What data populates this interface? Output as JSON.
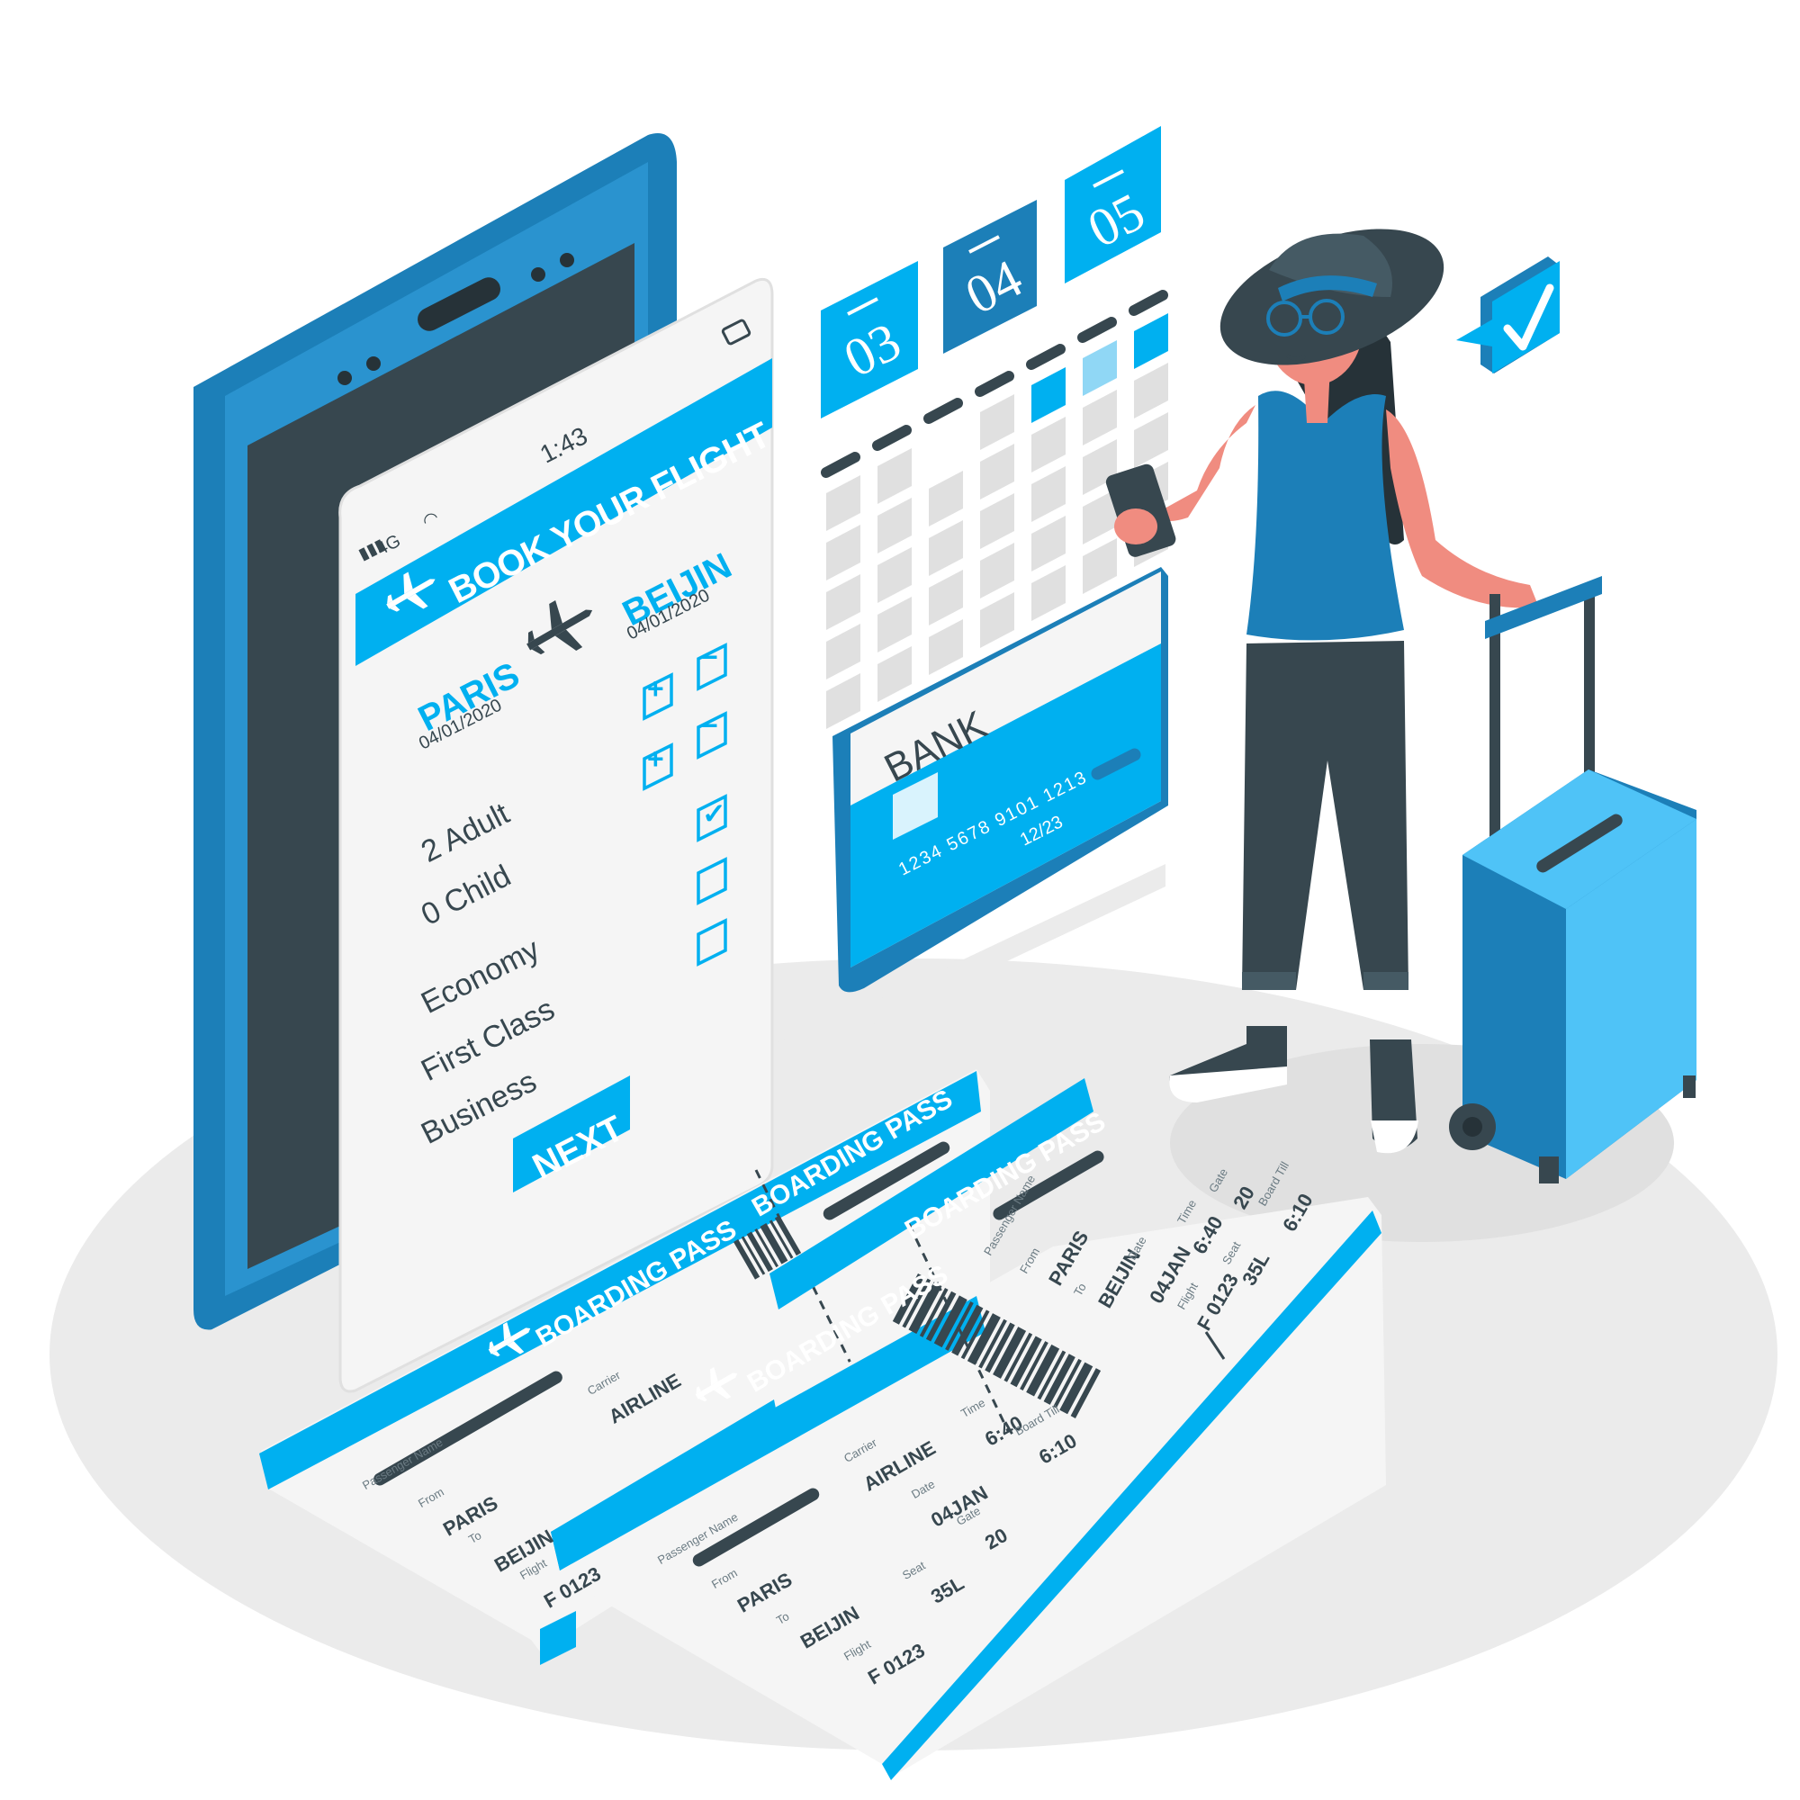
{
  "colors": {
    "brand": "#00b0f0",
    "brand_dark": "#1c7fb8",
    "dark": "#37474f",
    "shadow": "#ebebeb",
    "paper": "#f5f5f5",
    "skin": "#f08c80"
  },
  "phone": {
    "status": {
      "signal": "4G",
      "time": "1:43"
    },
    "header_title": "BOOK YOUR FLIGHT",
    "from_city": "PARIS",
    "from_date": "04/01/2020",
    "to_city": "BEIJIN",
    "to_date": "04/01/2020",
    "adult_label": "2 Adult",
    "child_label": "0 Child",
    "classes": [
      "Economy",
      "First Class",
      "Business"
    ],
    "plus_symbol": "+",
    "minus_symbol": "−",
    "check_symbol": "✓",
    "next_label": "NEXT"
  },
  "calendar": {
    "days": [
      "03",
      "04",
      "05"
    ]
  },
  "card": {
    "bank_name": "BANK",
    "number": "1234  5678  9101  1213",
    "expiry": "12/23"
  },
  "boarding_passes": [
    {
      "header": "BOARDING PASS",
      "stub_header": "BOARDING PASS",
      "passenger_label": "Passenger Name",
      "carrier_label": "Carrier",
      "carrier": "AIRLINE",
      "from_label": "From",
      "from": "PARIS",
      "to_label": "To",
      "to": "BEIJIN",
      "flight_label": "Flight",
      "flight": "F 0123"
    },
    {
      "header": "BOARDING PASS",
      "stub_header": "BOARDING PASS",
      "passenger_label": "Passenger Name",
      "carrier_label": "Carrier",
      "carrier": "AIRLINE",
      "date_label": "Date",
      "date": "04JAN",
      "time_label": "Time",
      "time": "6:40",
      "gate_label": "Gate",
      "gate": "20",
      "board_label": "Board Till",
      "board": "6:10",
      "from_label": "From",
      "from": "PARIS",
      "to_label": "To",
      "to": "BEIJIN",
      "flight_label": "Flight",
      "flight": "F 0123",
      "seat_label": "Seat",
      "seat": "35L",
      "stub": {
        "passenger_label": "Passenger Name",
        "from_label": "From",
        "from": "PARIS",
        "to_label": "To",
        "to": "BEIJIN",
        "date_label": "Date",
        "date": "04JAN",
        "time_label": "Time",
        "time": "6:40",
        "gate_label": "Gate",
        "gate": "20",
        "board_label": "Board Till",
        "board": "6:10",
        "flight_label": "Flight",
        "flight": "F 0123",
        "seat_label": "Seat",
        "seat": "35L"
      }
    }
  ],
  "icons": [
    "airplane-icon",
    "signal-icon",
    "wifi-icon",
    "battery-icon",
    "checkmark-badge-icon",
    "chip-icon",
    "barcode-icon"
  ]
}
